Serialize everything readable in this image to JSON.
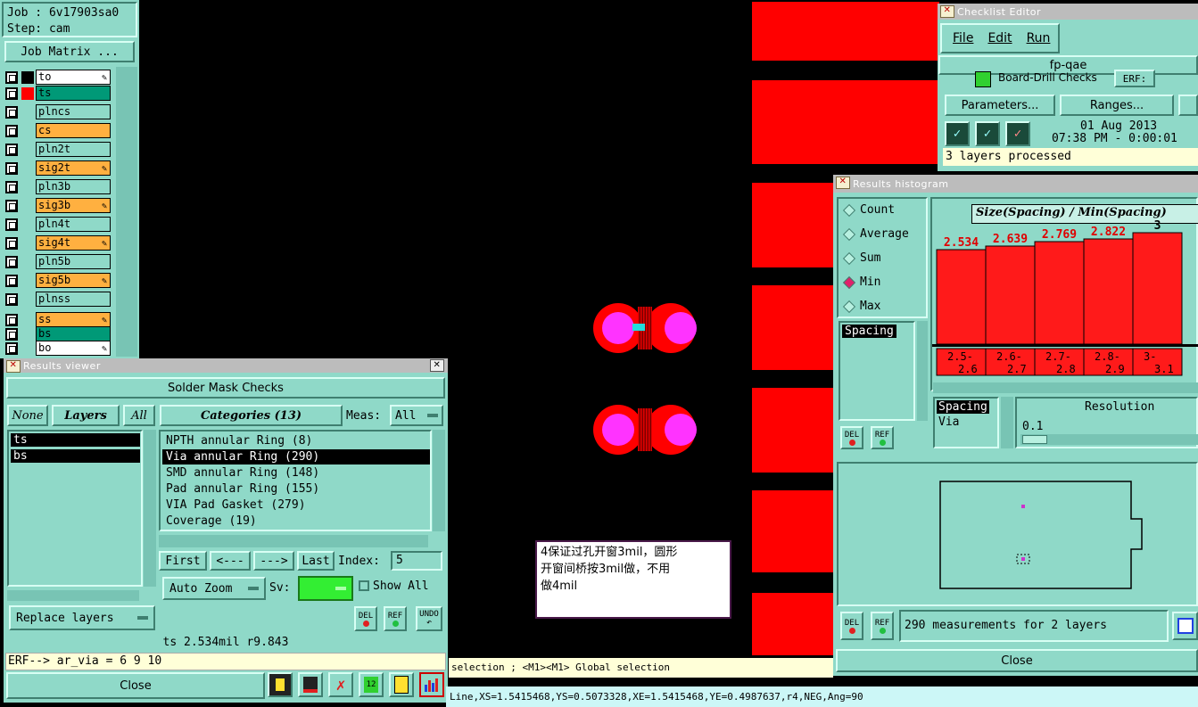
{
  "job": {
    "job_label": "Job : 6v17903sa0",
    "step_label": "Step: cam",
    "job_matrix_button": "Job Matrix ..."
  },
  "layers": [
    {
      "name": "to",
      "color": "#ffffff",
      "swatch": "#000000",
      "flag": true
    },
    {
      "name": "ts",
      "color": "#009977",
      "swatch": "#ff0000",
      "flag": false
    },
    {
      "name": "plncs",
      "color": "#8fd9c8",
      "swatch": "",
      "flag": false
    },
    {
      "name": "cs",
      "color": "#ffb040",
      "swatch": "",
      "flag": false
    },
    {
      "name": "pln2t",
      "color": "#8fd9c8",
      "swatch": "",
      "flag": false
    },
    {
      "name": "sig2t",
      "color": "#ffb040",
      "swatch": "",
      "flag": true
    },
    {
      "name": "pln3b",
      "color": "#8fd9c8",
      "swatch": "",
      "flag": false
    },
    {
      "name": "sig3b",
      "color": "#ffb040",
      "swatch": "",
      "flag": true
    },
    {
      "name": "pln4t",
      "color": "#8fd9c8",
      "swatch": "",
      "flag": false
    },
    {
      "name": "sig4t",
      "color": "#ffb040",
      "swatch": "",
      "flag": true
    },
    {
      "name": "pln5b",
      "color": "#8fd9c8",
      "swatch": "",
      "flag": false
    },
    {
      "name": "sig5b",
      "color": "#ffb040",
      "swatch": "",
      "flag": true
    },
    {
      "name": "plnss",
      "color": "#8fd9c8",
      "swatch": "",
      "flag": false
    },
    {
      "name": "ss",
      "color": "#ffb040",
      "swatch": "",
      "flag": true
    },
    {
      "name": "bs",
      "color": "#009977",
      "swatch": "",
      "flag": false
    },
    {
      "name": "bo",
      "color": "#ffffff",
      "swatch": "",
      "flag": true
    }
  ],
  "results_viewer": {
    "title": "Results viewer",
    "header": "Solder Mask Checks",
    "none_btn": "None",
    "layers_btn": "Layers",
    "all_btn": "All",
    "categories_btn": "Categories (13)",
    "meas_label": "Meas:",
    "meas_value": "All",
    "layer_list": [
      "ts",
      "bs"
    ],
    "categories": [
      {
        "label": "NPTH annular Ring (8)",
        "selected": false
      },
      {
        "label": "Via annular Ring (290)",
        "selected": true
      },
      {
        "label": "SMD annular Ring (148)",
        "selected": false
      },
      {
        "label": "Pad annular Ring (155)",
        "selected": false
      },
      {
        "label": "VIA Pad Gasket (279)",
        "selected": false
      },
      {
        "label": "Coverage (19)",
        "selected": false
      }
    ],
    "first_btn": "First",
    "prev_btn": "<---",
    "next_btn": "--->",
    "last_btn": "Last",
    "index_label": "Index:",
    "index_value": "5",
    "auto_zoom": "Auto Zoom",
    "sv_label": "Sv:",
    "show_all": "Show All",
    "replace_layers": "Replace layers",
    "del_btn": "DEL",
    "ref_btn": "REF",
    "undo_btn": "UNDO",
    "status_value": "ts 2.534mil  r9.843",
    "erf_line": "ERF--> ar_via = 6 9 10",
    "close_btn": "Close"
  },
  "checklist": {
    "title": "Checklist Editor",
    "menu": [
      "File",
      "Edit",
      "Run"
    ],
    "name": "fp-qae",
    "check_row": "Board-Drill Checks",
    "erf_btn": "ERF:",
    "parameters_btn": "Parameters...",
    "ranges_btn": "Ranges...",
    "date": "01 Aug 2013",
    "time": "07:38 PM - 0:00:01",
    "status": "3 layers processed"
  },
  "histogram": {
    "title": "Results histogram",
    "modes": [
      {
        "label": "Count",
        "selected": false
      },
      {
        "label": "Average",
        "selected": false
      },
      {
        "label": "Sum",
        "selected": false
      },
      {
        "label": "Min",
        "selected": true
      },
      {
        "label": "Max",
        "selected": false
      }
    ],
    "chart_title": "Size(Spacing) / Min(Spacing)",
    "bars": [
      {
        "value": "2.534",
        "top": "2.5-",
        "bottom": "2.6",
        "level": 0.845
      },
      {
        "value": "2.639",
        "top": "2.6-",
        "bottom": "2.7",
        "level": 0.88
      },
      {
        "value": "2.769",
        "top": "2.7-",
        "bottom": "2.8",
        "level": 0.923
      },
      {
        "value": "2.822",
        "top": "2.8-",
        "bottom": "2.9",
        "level": 0.94
      },
      {
        "value": "3",
        "top": "3-",
        "bottom": "3.1",
        "level": 1.0
      }
    ],
    "list_a": [
      "Spacing"
    ],
    "list_b": [
      "Spacing",
      "Via"
    ],
    "resolution_label": "Resolution",
    "resolution_value": "0.1",
    "del_btn": "DEL",
    "ref_btn": "REF",
    "measurements": "290 measurements for 2 layers",
    "close_btn": "Close"
  },
  "annotation": {
    "lines": [
      "4保证过孔开窗3mil，圆形",
      "开窗间桥按3mil做，不用",
      "做4mil"
    ]
  },
  "status_bar": {
    "message": "selection ; <M1><M1> Global selection",
    "coords": "Line,XS=1.5415468,YS=0.5073328,XE=1.5415468,YE=0.4987637,r4,NEG,Ang=90"
  }
}
